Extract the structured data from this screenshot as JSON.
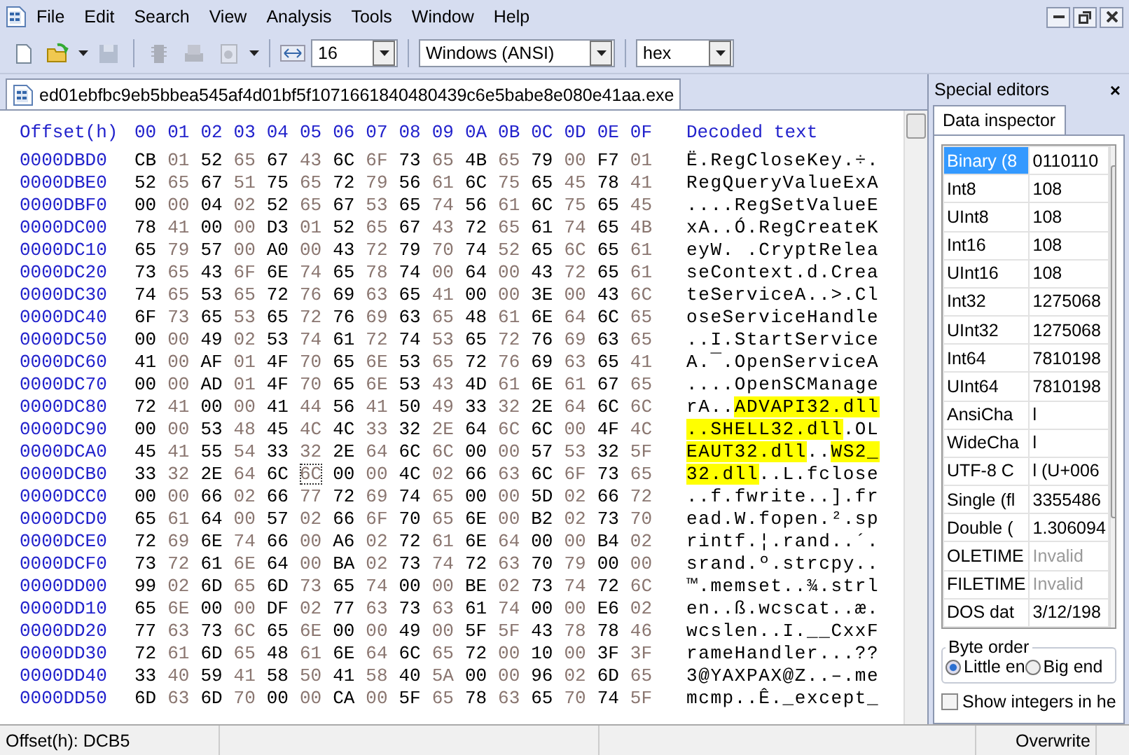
{
  "menu": [
    "File",
    "Edit",
    "Search",
    "View",
    "Analysis",
    "Tools",
    "Window",
    "Help"
  ],
  "window_controls": [
    {
      "kind": "minimize"
    },
    {
      "kind": "restore"
    },
    {
      "kind": "close"
    }
  ],
  "toolbar": {
    "buttons": [
      {
        "kind": "new",
        "disabled": false
      },
      {
        "kind": "open",
        "disabled": false
      },
      {
        "kind": "save",
        "disabled": true
      },
      {
        "kind": "chip",
        "disabled": true
      },
      {
        "kind": "disk",
        "disabled": true
      },
      {
        "kind": "page",
        "disabled": true
      }
    ],
    "bytes_per_row": "16",
    "charset": "Windows (ANSI)",
    "mode": "hex"
  },
  "file_tabs": [
    {
      "label": "ed01ebfbc9eb5bbea545af4d01bf5f1071661840480439c6e5babe8e080e41aa.exe",
      "selected": true
    }
  ],
  "hex": {
    "columns": [
      "Offset(h)",
      "00",
      "01",
      "02",
      "03",
      "04",
      "05",
      "06",
      "07",
      "08",
      "09",
      "0A",
      "0B",
      "0C",
      "0D",
      "0E",
      "0F",
      "Decoded text"
    ],
    "rows": [
      {
        "offset": "0000DBD0",
        "bytes": "CB 01 52 65 67 43 6C 6F 73 65 4B 65 79 00 F7 01",
        "decoded": [
          {
            "text": "Ë.RegCloseKey.÷.",
            "highlighted": false
          }
        ]
      },
      {
        "offset": "0000DBE0",
        "bytes": "52 65 67 51 75 65 72 79 56 61 6C 75 65 45 78 41",
        "decoded": [
          {
            "text": "RegQueryValueExA",
            "highlighted": false
          }
        ]
      },
      {
        "offset": "0000DBF0",
        "bytes": "00 00 04 02 52 65 67 53 65 74 56 61 6C 75 65 45",
        "decoded": [
          {
            "text": "....RegSetValueE",
            "highlighted": false
          }
        ]
      },
      {
        "offset": "0000DC00",
        "bytes": "78 41 00 00 D3 01 52 65 67 43 72 65 61 74 65 4B",
        "decoded": [
          {
            "text": "xA..Ó.RegCreateK",
            "highlighted": false
          }
        ]
      },
      {
        "offset": "0000DC10",
        "bytes": "65 79 57 00 A0 00 43 72 79 70 74 52 65 6C 65 61",
        "decoded": [
          {
            "text": "eyW. .CryptRelea",
            "highlighted": false
          }
        ]
      },
      {
        "offset": "0000DC20",
        "bytes": "73 65 43 6F 6E 74 65 78 74 00 64 00 43 72 65 61",
        "decoded": [
          {
            "text": "seContext.d.Crea",
            "highlighted": false
          }
        ]
      },
      {
        "offset": "0000DC30",
        "bytes": "74 65 53 65 72 76 69 63 65 41 00 00 3E 00 43 6C",
        "decoded": [
          {
            "text": "teServiceA..>.Cl",
            "highlighted": false
          }
        ]
      },
      {
        "offset": "0000DC40",
        "bytes": "6F 73 65 53 65 72 76 69 63 65 48 61 6E 64 6C 65",
        "decoded": [
          {
            "text": "oseServiceHandle",
            "highlighted": false
          }
        ]
      },
      {
        "offset": "0000DC50",
        "bytes": "00 00 49 02 53 74 61 72 74 53 65 72 76 69 63 65",
        "decoded": [
          {
            "text": "..I.StartService",
            "highlighted": false
          }
        ]
      },
      {
        "offset": "0000DC60",
        "bytes": "41 00 AF 01 4F 70 65 6E 53 65 72 76 69 63 65 41",
        "decoded": [
          {
            "text": "A.¯.OpenServiceA",
            "highlighted": false
          }
        ]
      },
      {
        "offset": "0000DC70",
        "bytes": "00 00 AD 01 4F 70 65 6E 53 43 4D 61 6E 61 67 65",
        "decoded": [
          {
            "text": "....OpenSCManage",
            "highlighted": false
          }
        ]
      },
      {
        "offset": "0000DC80",
        "bytes": "72 41 00 00 41 44 56 41 50 49 33 32 2E 64 6C 6C",
        "decoded": [
          {
            "text": "rA..",
            "highlighted": false
          },
          {
            "text": "ADVAPI32.dll",
            "highlighted": true
          }
        ]
      },
      {
        "offset": "0000DC90",
        "bytes": "00 00 53 48 45 4C 4C 33 32 2E 64 6C 6C 00 4F 4C",
        "decoded": [
          {
            "text": "..SHELL32.dll",
            "highlighted": true
          },
          {
            "text": ".OL",
            "highlighted": false
          }
        ]
      },
      {
        "offset": "0000DCA0",
        "bytes": "45 41 55 54 33 32 2E 64 6C 6C 00 00 57 53 32 5F",
        "decoded": [
          {
            "text": "EAUT32.dll",
            "highlighted": true
          },
          {
            "text": "..",
            "highlighted": false
          },
          {
            "text": "WS2_",
            "highlighted": true
          }
        ]
      },
      {
        "offset": "0000DCB0",
        "bytes": "33 32 2E 64 6C 6C 00 00 4C 02 66 63 6C 6F 73 65",
        "cursor": [
          false,
          false,
          false,
          false,
          false,
          true,
          false,
          false,
          false,
          false,
          false,
          false,
          false,
          false,
          false,
          false
        ],
        "decoded": [
          {
            "text": "32.dll",
            "highlighted": true
          },
          {
            "text": "..L.fclose",
            "highlighted": false
          }
        ]
      },
      {
        "offset": "0000DCC0",
        "bytes": "00 00 66 02 66 77 72 69 74 65 00 00 5D 02 66 72",
        "decoded": [
          {
            "text": "..f.fwrite..].fr",
            "highlighted": false
          }
        ]
      },
      {
        "offset": "0000DCD0",
        "bytes": "65 61 64 00 57 02 66 6F 70 65 6E 00 B2 02 73 70",
        "decoded": [
          {
            "text": "ead.W.fopen.².sp",
            "highlighted": false
          }
        ]
      },
      {
        "offset": "0000DCE0",
        "bytes": "72 69 6E 74 66 00 A6 02 72 61 6E 64 00 00 B4 02",
        "decoded": [
          {
            "text": "rintf.¦.rand..´.",
            "highlighted": false
          }
        ]
      },
      {
        "offset": "0000DCF0",
        "bytes": "73 72 61 6E 64 00 BA 02 73 74 72 63 70 79 00 00",
        "decoded": [
          {
            "text": "srand.º.strcpy..",
            "highlighted": false
          }
        ]
      },
      {
        "offset": "0000DD00",
        "bytes": "99 02 6D 65 6D 73 65 74 00 00 BE 02 73 74 72 6C",
        "decoded": [
          {
            "text": "™.memset..¾.strl",
            "highlighted": false
          }
        ]
      },
      {
        "offset": "0000DD10",
        "bytes": "65 6E 00 00 DF 02 77 63 73 63 61 74 00 00 E6 02",
        "decoded": [
          {
            "text": "en..ß.wcscat..æ.",
            "highlighted": false
          }
        ]
      },
      {
        "offset": "0000DD20",
        "bytes": "77 63 73 6C 65 6E 00 00 49 00 5F 5F 43 78 78 46",
        "decoded": [
          {
            "text": "wcslen..I.__CxxF",
            "highlighted": false
          }
        ]
      },
      {
        "offset": "0000DD30",
        "bytes": "72 61 6D 65 48 61 6E 64 6C 65 72 00 10 00 3F 3F",
        "decoded": [
          {
            "text": "rameHandler...??",
            "highlighted": false
          }
        ]
      },
      {
        "offset": "0000DD40",
        "bytes": "33 40 59 41 58 50 41 58 40 5A 00 00 96 02 6D 65",
        "decoded": [
          {
            "text": "3@YAXPAX@Z..–.me",
            "highlighted": false
          }
        ]
      },
      {
        "offset": "0000DD50",
        "bytes": "6D 63 6D 70 00 00 CA 00 5F 65 78 63 65 70 74 5F",
        "decoded": [
          {
            "text": "mcmp..Ê._except_",
            "highlighted": false
          }
        ]
      }
    ]
  },
  "special_editors": {
    "title": "Special editors",
    "close": "×",
    "tabs": [
      {
        "label": "Data inspector",
        "selected": true
      }
    ],
    "inspector": [
      {
        "name": "Binary (8",
        "value": "0110110",
        "selected": true,
        "greyed": false
      },
      {
        "name": "Int8",
        "value": "108",
        "selected": false,
        "greyed": false
      },
      {
        "name": "UInt8",
        "value": "108",
        "selected": false,
        "greyed": false
      },
      {
        "name": "Int16",
        "value": "108",
        "selected": false,
        "greyed": false
      },
      {
        "name": "UInt16",
        "value": "108",
        "selected": false,
        "greyed": false
      },
      {
        "name": "Int32",
        "value": "1275068",
        "selected": false,
        "greyed": false
      },
      {
        "name": "UInt32",
        "value": "1275068",
        "selected": false,
        "greyed": false
      },
      {
        "name": "Int64",
        "value": "7810198",
        "selected": false,
        "greyed": false
      },
      {
        "name": "UInt64",
        "value": "7810198",
        "selected": false,
        "greyed": false
      },
      {
        "name": "AnsiCha",
        "value": "l",
        "selected": false,
        "greyed": false
      },
      {
        "name": "WideCha",
        "value": "l",
        "selected": false,
        "greyed": false
      },
      {
        "name": "UTF-8 C",
        "value": "l (U+006",
        "selected": false,
        "greyed": false
      },
      {
        "name": "Single (fl",
        "value": "3355486",
        "selected": false,
        "greyed": false
      },
      {
        "name": "Double (",
        "value": "1.306094",
        "selected": false,
        "greyed": false
      },
      {
        "name": "OLETIME",
        "value": "Invalid",
        "selected": false,
        "greyed": true
      },
      {
        "name": "FILETIME",
        "value": "Invalid",
        "selected": false,
        "greyed": true
      },
      {
        "name": "DOS dat",
        "value": "3/12/198",
        "selected": false,
        "greyed": false
      }
    ],
    "byte_order": {
      "title": "Byte order",
      "options": [
        {
          "label": "Little en",
          "selected": true
        },
        {
          "label": "Big end",
          "selected": false
        }
      ]
    },
    "show_hex": {
      "label": "Show integers in he",
      "checked": false
    }
  },
  "status_bar": [
    {
      "text": "Offset(h): DCB5"
    },
    {
      "text": "Overwrite"
    }
  ]
}
